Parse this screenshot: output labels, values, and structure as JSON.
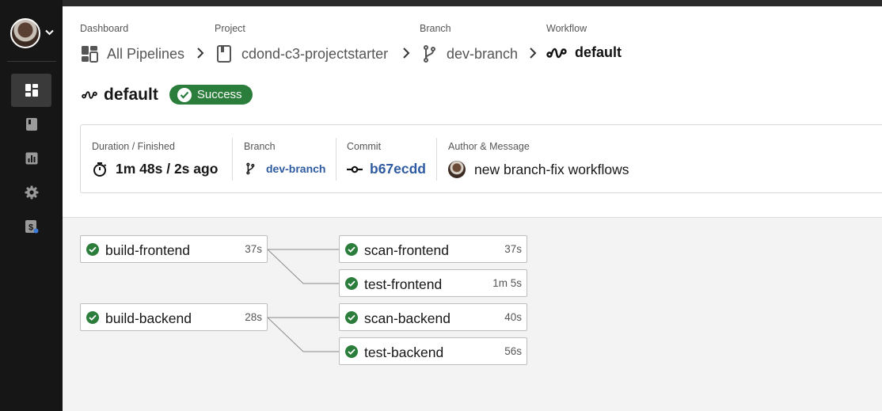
{
  "sidebar": {
    "items": [
      {
        "icon": "dashboard-icon",
        "active": true
      },
      {
        "icon": "projects-icon",
        "active": false
      },
      {
        "icon": "insights-icon",
        "active": false
      },
      {
        "icon": "settings-icon",
        "active": false
      },
      {
        "icon": "plan-icon",
        "active": false
      }
    ]
  },
  "breadcrumb": {
    "dashboard": {
      "label": "Dashboard",
      "value": "All Pipelines"
    },
    "project": {
      "label": "Project",
      "value": "cdond-c3-projectstarter"
    },
    "branch": {
      "label": "Branch",
      "value": "dev-branch"
    },
    "workflow": {
      "label": "Workflow",
      "value": "default"
    }
  },
  "workflow": {
    "title": "default",
    "status": "Success",
    "status_color": "#2b7d3b"
  },
  "info": {
    "duration": {
      "label": "Duration / Finished",
      "value": "1m 48s / 2s ago"
    },
    "branch": {
      "label": "Branch",
      "value": "dev-branch"
    },
    "commit": {
      "label": "Commit",
      "value": "b67ecdd"
    },
    "author": {
      "label": "Author & Message",
      "value": "new branch-fix workflows"
    }
  },
  "jobs": [
    {
      "name": "build-frontend",
      "duration": "37s"
    },
    {
      "name": "scan-frontend",
      "duration": "37s"
    },
    {
      "name": "test-frontend",
      "duration": "1m 5s"
    },
    {
      "name": "build-backend",
      "duration": "28s"
    },
    {
      "name": "scan-backend",
      "duration": "40s"
    },
    {
      "name": "test-backend",
      "duration": "56s"
    }
  ],
  "colors": {
    "sidebar_bg": "#161616",
    "link": "#2d5aa0",
    "success": "#2b7d3b"
  }
}
